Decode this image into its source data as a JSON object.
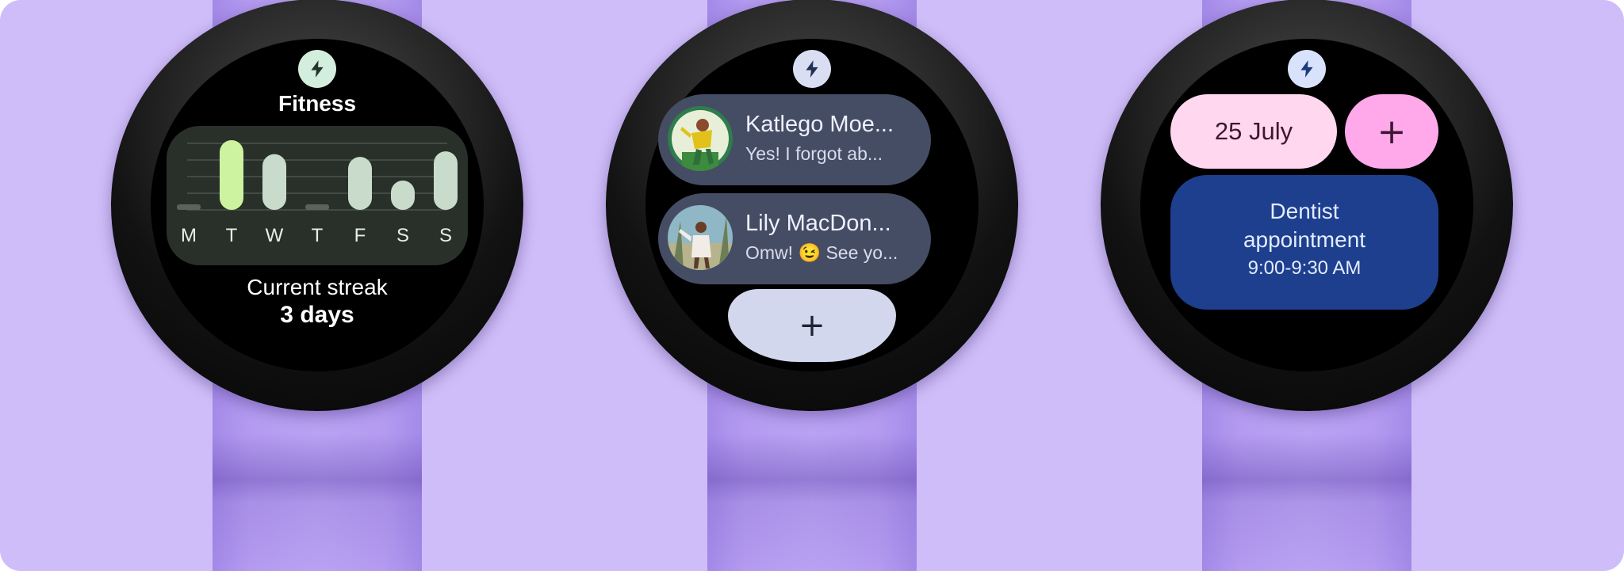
{
  "colors": {
    "background": "#cfbdf9",
    "strap": "#b49bf0",
    "fitness_accent": "#cdf2a0",
    "messaging_chip": "#454d64",
    "calendar_date_pill": "#ffd8ef",
    "calendar_add": "#ffa8ea",
    "calendar_event": "#1d3f8e"
  },
  "fitness_tile": {
    "app_icon": "lightning-bolt-icon",
    "title": "Fitness",
    "streak_label": "Current streak",
    "streak_value": "3 days"
  },
  "chart_data": {
    "type": "bar",
    "categories": [
      "M",
      "T",
      "W",
      "T",
      "F",
      "S",
      "S"
    ],
    "values": [
      0,
      5,
      4,
      0,
      3.8,
      2.1,
      4.2
    ],
    "highlight_index": 1,
    "ylim": [
      0,
      5
    ],
    "grid": true
  },
  "messaging_tile": {
    "app_icon": "lightning-bolt-icon",
    "contacts": [
      {
        "name": "Katlego Moe...",
        "message": "Yes! I forgot ab...",
        "avatar": "avatar-person-green"
      },
      {
        "name": "Lily MacDon...",
        "message": "Omw! 😉 See yo...",
        "avatar": "avatar-person-field"
      }
    ],
    "add_label": "+"
  },
  "calendar_tile": {
    "app_icon": "lightning-bolt-icon",
    "date": "25 July",
    "add_label": "+",
    "event_title": "Dentist appointment",
    "event_time": "9:00-9:30 AM"
  }
}
